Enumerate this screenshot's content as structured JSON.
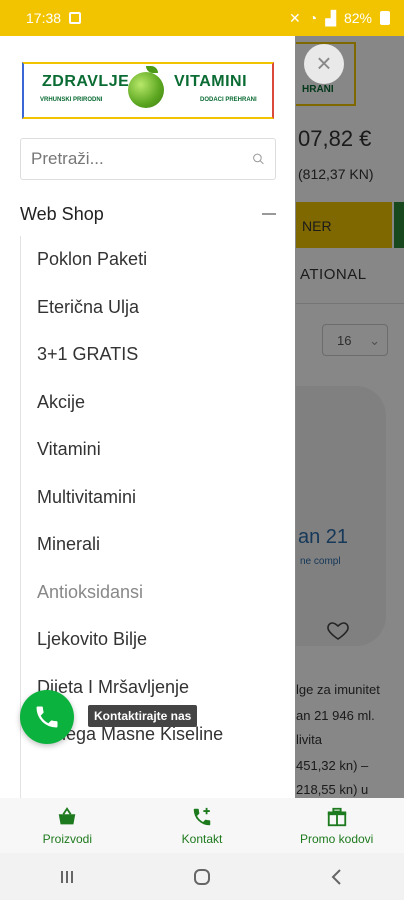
{
  "status_bar": {
    "time": "17:38",
    "battery": "82%"
  },
  "background_page": {
    "logo_fragment": "HRANI",
    "price": "07,82 €",
    "price_kn": "(812,37 KN)",
    "banner_text": "NER",
    "tab_text": "ATIONAL",
    "sort_value": "16",
    "product_name": "an 21",
    "product_sub": "ne compl",
    "text_line1": "lge za imunitet",
    "text_line2": "an 21 946 ml.",
    "text_line3": "livita",
    "text_line4": "451,32 kn) –",
    "text_line5": "218,55 kn) u"
  },
  "drawer": {
    "logo": {
      "word_left": "ZDRAVLJE",
      "word_right": "VITAMINI",
      "sub_left": "VRHUNSKI PRIRODNI",
      "sub_right": "DODACI PREHRANI"
    },
    "search": {
      "placeholder": "Pretraži..."
    },
    "section_title": "Web Shop",
    "menu_items": [
      "Poklon Paketi",
      "Eterična Ulja",
      "3+1 GRATIS",
      "Akcije",
      "Vitamini",
      "Multivitamini",
      "Minerali",
      "Antioksidansi",
      "Ljekovito Bilje",
      "Dijeta I Mršavljenje",
      "Omega Masne Kiseline"
    ]
  },
  "contact": {
    "tooltip": "Kontaktirajte nas"
  },
  "bottom_nav": [
    {
      "label": "Proizvodi",
      "icon": "basket-icon"
    },
    {
      "label": "Kontakt",
      "icon": "phone-plus-icon"
    },
    {
      "label": "Promo kodovi",
      "icon": "gift-icon"
    }
  ],
  "colors": {
    "accent_yellow": "#f2c400",
    "brand_green": "#0a6b33",
    "call_green": "#0cb23e",
    "nav_green": "#1e7a1e"
  }
}
